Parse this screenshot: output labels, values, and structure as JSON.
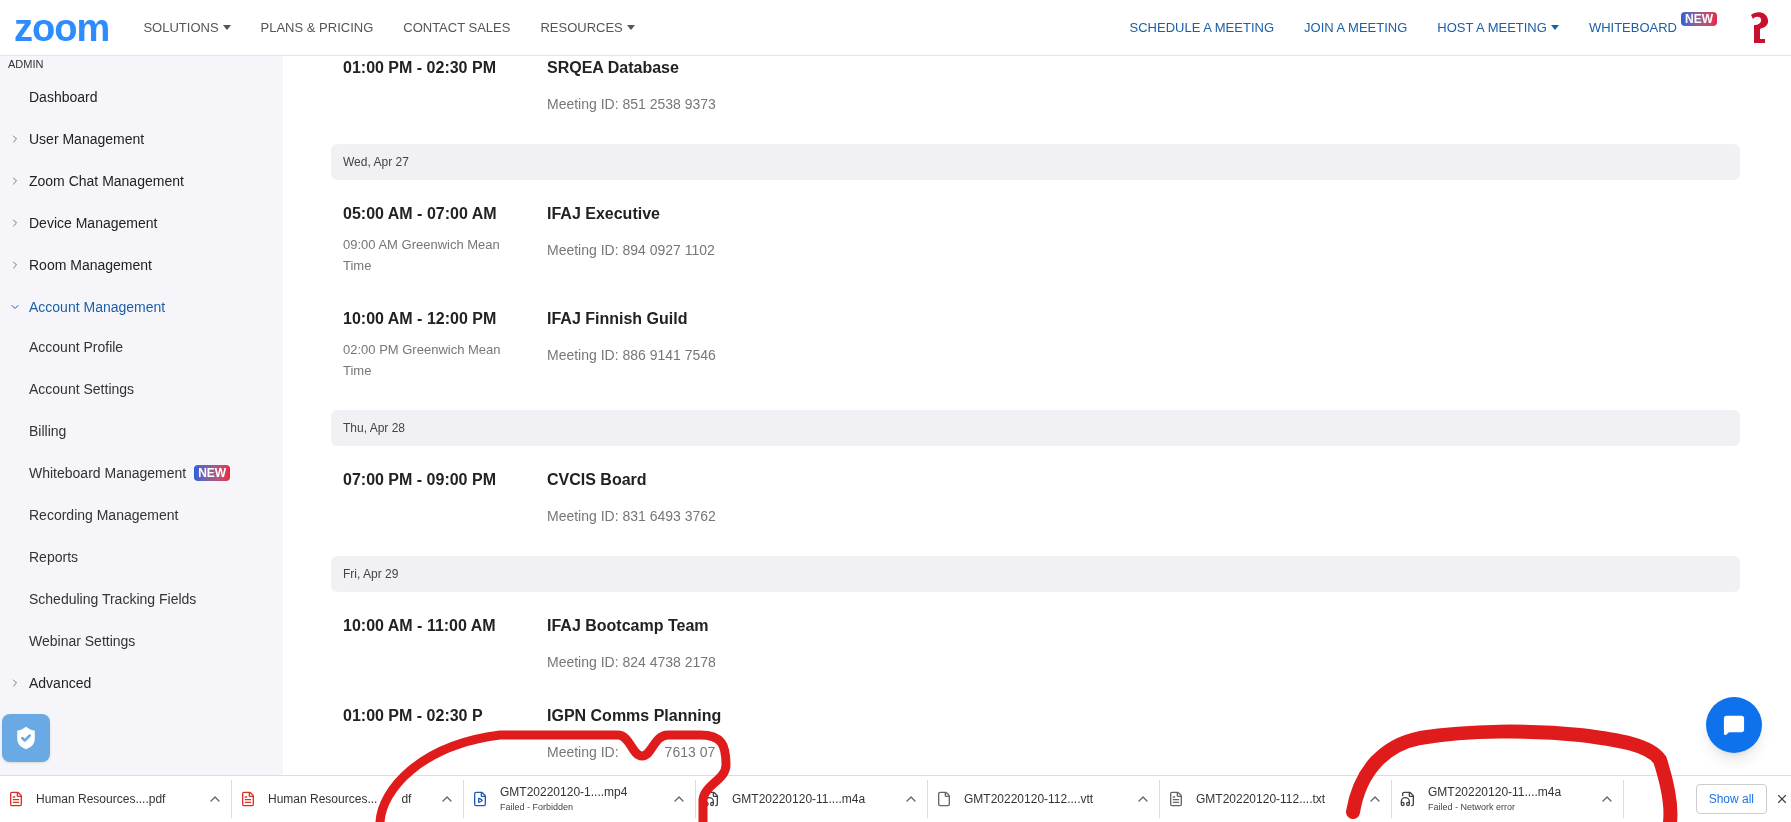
{
  "header": {
    "logo": "zoom",
    "nav": [
      {
        "label": "SOLUTIONS",
        "dropdown": true
      },
      {
        "label": "PLANS & PRICING",
        "dropdown": false
      },
      {
        "label": "CONTACT SALES",
        "dropdown": false
      },
      {
        "label": "RESOURCES",
        "dropdown": true
      }
    ],
    "actions": [
      {
        "label": "SCHEDULE A MEETING",
        "dropdown": false
      },
      {
        "label": "JOIN A MEETING",
        "dropdown": false
      },
      {
        "label": "HOST A MEETING",
        "dropdown": true
      },
      {
        "label": "WHITEBOARD",
        "dropdown": false,
        "badge": "NEW"
      }
    ]
  },
  "sidebar": {
    "section": "ADMIN",
    "items": [
      {
        "label": "Dashboard",
        "kind": "link",
        "selected": false
      },
      {
        "label": "User Management",
        "kind": "group",
        "expanded": false,
        "selected": false
      },
      {
        "label": "Zoom Chat Management",
        "kind": "group",
        "expanded": false,
        "selected": false
      },
      {
        "label": "Device Management",
        "kind": "group",
        "expanded": false,
        "selected": false
      },
      {
        "label": "Room Management",
        "kind": "group",
        "expanded": false,
        "selected": false
      },
      {
        "label": "Account Management",
        "kind": "group",
        "expanded": true,
        "selected": true,
        "children": [
          {
            "label": "Account Profile"
          },
          {
            "label": "Account Settings"
          },
          {
            "label": "Billing"
          },
          {
            "label": "Whiteboard Management",
            "badge": "NEW"
          },
          {
            "label": "Recording Management"
          },
          {
            "label": "Reports"
          },
          {
            "label": "Scheduling Tracking Fields"
          },
          {
            "label": "Webinar Settings"
          }
        ]
      },
      {
        "label": "Advanced",
        "kind": "group",
        "expanded": false,
        "selected": false
      }
    ]
  },
  "schedule": [
    {
      "meetings": [
        {
          "time": "01:00 PM - 02:30 PM",
          "title": "SRQEA Database",
          "meeting_id": "Meeting ID: 851 2538 9373"
        }
      ]
    },
    {
      "date": "Wed, Apr 27",
      "meetings": [
        {
          "time": "05:00 AM - 07:00 AM",
          "local_time": "09:00 AM Greenwich Mean Time",
          "title": "IFAJ Executive",
          "meeting_id": "Meeting ID: 894 0927 1102"
        },
        {
          "time": "10:00 AM - 12:00 PM",
          "local_time": "02:00 PM Greenwich Mean Time",
          "title": "IFAJ Finnish Guild",
          "meeting_id": "Meeting ID: 886 9141 7546"
        }
      ]
    },
    {
      "date": "Thu, Apr 28",
      "meetings": [
        {
          "time": "07:00 PM - 09:00 PM",
          "title": "CVCIS Board",
          "meeting_id": "Meeting ID: 831 6493 3762"
        }
      ]
    },
    {
      "date": "Fri, Apr 29",
      "meetings": [
        {
          "time": "10:00 AM - 11:00 AM",
          "title": "IFAJ Bootcamp Team",
          "meeting_id": "Meeting ID: 824 4738 2178"
        },
        {
          "time": "01:00 PM - 02:30 P",
          "title": "IGPN Comms Planning",
          "meeting_id": "Meeting ID:",
          "meeting_id_tail": "7613 07"
        }
      ]
    }
  ],
  "downloads": {
    "items": [
      {
        "name": "Human Resources....pdf",
        "kind": "pdf"
      },
      {
        "name": "Human Resources...",
        "name_tail": "df",
        "kind": "pdf"
      },
      {
        "name": "GMT20220120-1....mp4",
        "kind": "video",
        "status": "Failed - Forbidden"
      },
      {
        "name": "GMT20220120-11....m4a",
        "kind": "audio"
      },
      {
        "name": "GMT20220120-112....vtt",
        "kind": "file"
      },
      {
        "name": "GMT20220120-112....txt",
        "kind": "text"
      },
      {
        "name": "GMT20220120-11....m4a",
        "kind": "audio",
        "status": "Failed - Network error"
      }
    ],
    "show_all": "Show all"
  }
}
